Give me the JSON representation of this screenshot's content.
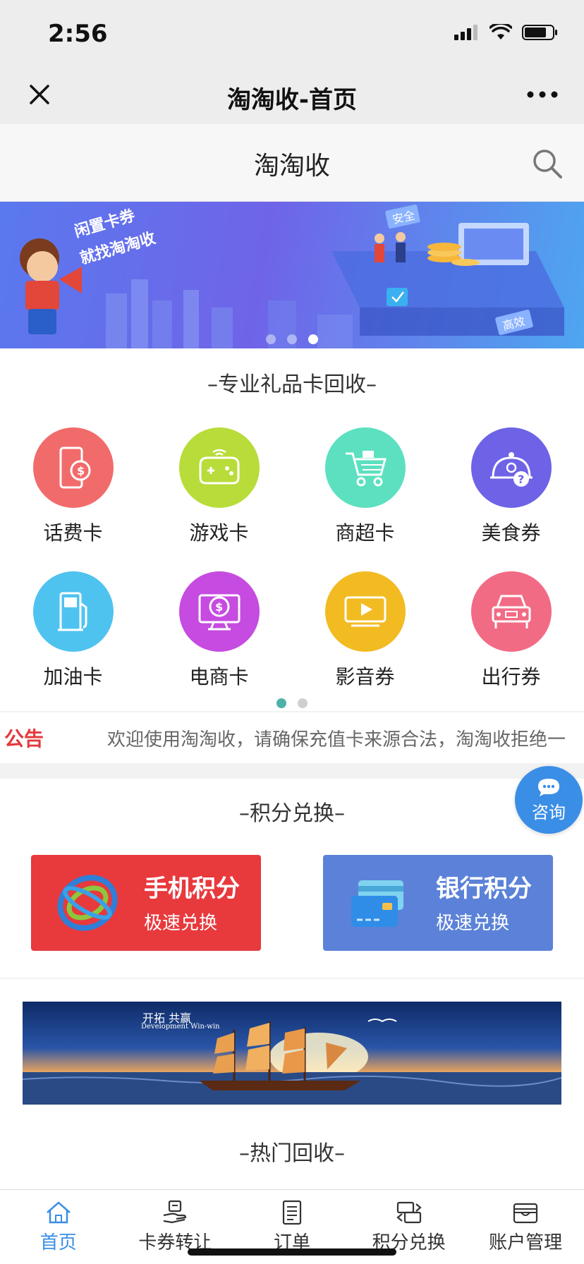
{
  "status_bar": {
    "time": "2:56"
  },
  "nav": {
    "title": "淘淘收-首页"
  },
  "header": {
    "title": "淘淘收"
  },
  "banner": {
    "slogan_line1": "闲置卡券",
    "slogan_line2": "就找淘淘收",
    "tag_safe": "安全",
    "tag_fast": "高效",
    "active_slide": 3,
    "slide_count": 3
  },
  "gift_section": {
    "title": "–专业礼品卡回收–",
    "items": [
      {
        "label": "话费卡",
        "icon": "phone-card-icon",
        "color": "#f26b6b"
      },
      {
        "label": "游戏卡",
        "icon": "gamepad-icon",
        "color": "#b8dc3a"
      },
      {
        "label": "商超卡",
        "icon": "shopping-cart-icon",
        "color": "#5ce0c0"
      },
      {
        "label": "美食券",
        "icon": "food-cloche-icon",
        "color": "#6e63e6"
      },
      {
        "label": "加油卡",
        "icon": "fuel-pump-icon",
        "color": "#4fc3f0"
      },
      {
        "label": "电商卡",
        "icon": "ecommerce-monitor-icon",
        "color": "#c64be0"
      },
      {
        "label": "影音券",
        "icon": "video-play-icon",
        "color": "#f2bb22"
      },
      {
        "label": "出行券",
        "icon": "car-icon",
        "color": "#f26b85"
      }
    ],
    "active_page": 1,
    "page_count": 2
  },
  "notice": {
    "label": "公告",
    "text": "欢迎使用淘淘收，请确保充值卡来源合法，淘淘收拒绝一"
  },
  "consult": {
    "label": "咨询"
  },
  "points_section": {
    "title": "–积分兑换–",
    "cards": [
      {
        "title": "手机积分",
        "subtitle": "极速兑换",
        "color": "#e8393d"
      },
      {
        "title": "银行积分",
        "subtitle": "极速兑换",
        "color": "#5b82d8"
      }
    ]
  },
  "promo": {
    "title": "开拓 共赢",
    "subtitle": "Development Win-win"
  },
  "hot_section": {
    "title": "–热门回收–"
  },
  "tab_bar": {
    "tabs": [
      {
        "label": "首页",
        "icon": "home-icon",
        "active": true
      },
      {
        "label": "卡券转让",
        "icon": "card-transfer-icon",
        "active": false
      },
      {
        "label": "订单",
        "icon": "order-list-icon",
        "active": false
      },
      {
        "label": "积分兑换",
        "icon": "exchange-icon",
        "active": false
      },
      {
        "label": "账户管理",
        "icon": "wallet-icon",
        "active": false
      }
    ]
  },
  "colors": {
    "accent": "#3a8ee6",
    "notice_red": "#e4393c"
  }
}
